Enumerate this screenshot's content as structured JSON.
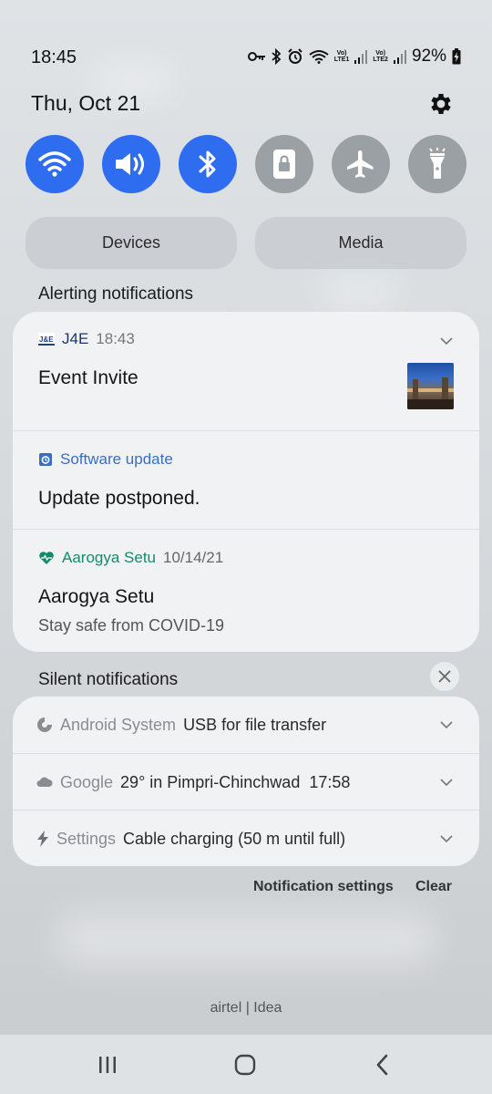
{
  "status_bar": {
    "time": "18:45",
    "sim1_label_top": "Vo)",
    "sim1_label_bottom": "LTE1",
    "sim2_label_top": "Vo)",
    "sim2_label_bottom": "LTE2",
    "battery": "92%"
  },
  "header": {
    "date": "Thu, Oct 21"
  },
  "quick_toggles": [
    {
      "name": "wifi",
      "state": "on"
    },
    {
      "name": "sound",
      "state": "on"
    },
    {
      "name": "bluetooth",
      "state": "on"
    },
    {
      "name": "screen-lock-rotation",
      "state": "off"
    },
    {
      "name": "airplane",
      "state": "off"
    },
    {
      "name": "flashlight",
      "state": "off"
    }
  ],
  "pills": {
    "devices": "Devices",
    "media": "Media"
  },
  "alerting": {
    "label": "Alerting notifications",
    "items": [
      {
        "app": "J4E",
        "time": "18:43",
        "title": "Event Invite",
        "icon": "j4e-logo-icon"
      },
      {
        "app": "Software update",
        "title": "Update postponed.",
        "icon": "software-update-icon",
        "app_color": "#3a6fc0"
      },
      {
        "app": "Aarogya Setu",
        "time": "10/14/21",
        "title": "Aarogya Setu",
        "subtitle": "Stay safe from COVID-19",
        "icon": "heart-icon",
        "app_color": "#148a6c"
      }
    ]
  },
  "silent": {
    "label": "Silent notifications",
    "items": [
      {
        "app": "Android System",
        "message": "USB for file transfer",
        "icon": "android-system-icon"
      },
      {
        "app": "Google",
        "message": "29° in Pimpri-Chinchwad  17:58",
        "icon": "cloud-icon"
      },
      {
        "app": "Settings",
        "message": "Cable charging (50 m until full)",
        "icon": "charging-bolt-icon"
      }
    ]
  },
  "actions": {
    "notification_settings": "Notification settings",
    "clear": "Clear"
  },
  "carrier": "airtel | Idea",
  "colors": {
    "toggle_on": "#2f6df0",
    "toggle_off": "#9aa0a4",
    "software_update": "#3a6fc0",
    "aarogya": "#148a6c"
  }
}
